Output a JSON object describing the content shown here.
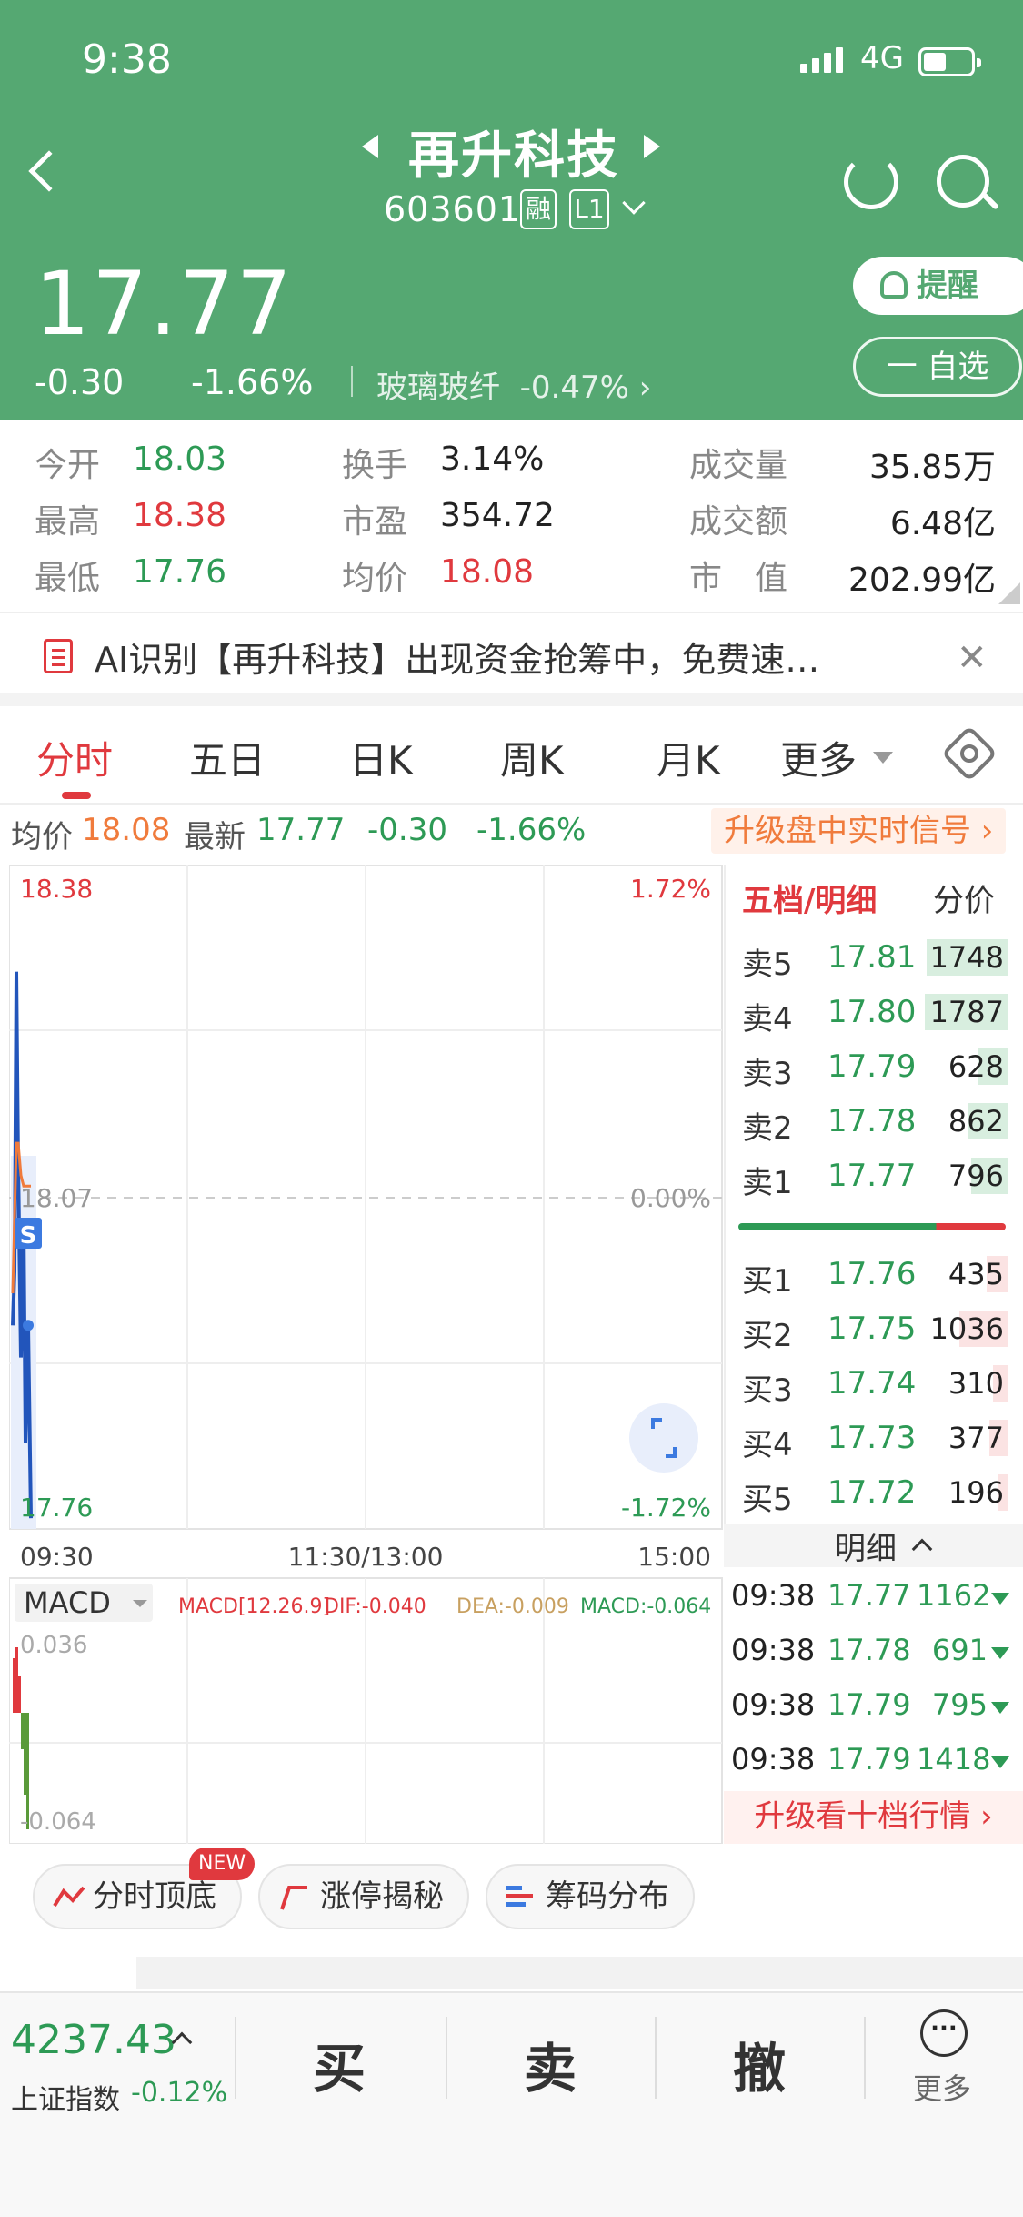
{
  "status_bar": {
    "time": "9:38",
    "network": "4G"
  },
  "header": {
    "stock_name": "再升科技",
    "stock_code": "603601",
    "badge_margin": "融",
    "badge_level": "L1",
    "price": "17.77",
    "change": "-0.30",
    "change_pct": "-1.66%",
    "sector_name": "玻璃玻纤",
    "sector_change": "-0.47%",
    "remind_label": "提醒",
    "watchlist_label": "一 自选"
  },
  "stats": {
    "open_label": "今开",
    "open": "18.03",
    "high_label": "最高",
    "high": "18.38",
    "low_label": "最低",
    "low": "17.76",
    "turnover_label": "换手",
    "turnover": "3.14%",
    "pe_label": "市盈",
    "pe": "354.72",
    "avg_label": "均价",
    "avg": "18.08",
    "volume_label": "成交量",
    "volume": "35.85万",
    "amount_label": "成交额",
    "amount": "6.48亿",
    "mktcap_label": "市　值",
    "mktcap": "202.99亿"
  },
  "ai_banner": {
    "text": "AI识别【再升科技】出现资金抢筹中，免费速…",
    "close": "✕"
  },
  "tabs": [
    "分时",
    "五日",
    "日K",
    "周K",
    "月K",
    "更多"
  ],
  "info_line": {
    "avg_label": "均价",
    "avg": "18.08",
    "latest_label": "最新",
    "latest": "17.77",
    "change": "-0.30",
    "change_pct": "-1.66%",
    "upgrade": "升级盘中实时信号 ›"
  },
  "chart_data": [
    {
      "type": "line",
      "title": "分时",
      "y_labels": {
        "top": "18.38",
        "mid": "18.07",
        "bottom": "17.76"
      },
      "pct_labels": {
        "top": "1.72%",
        "mid": "0.00%",
        "bottom": "-1.72%"
      },
      "ylim": [
        17.76,
        18.38
      ],
      "x_labels": [
        "09:30",
        "11:30/13:00",
        "15:00"
      ],
      "series": [
        {
          "name": "价格",
          "values": [
            17.95,
            18.0,
            18.28,
            18.1,
            17.92,
            18.05,
            17.84,
            17.95,
            17.77
          ]
        },
        {
          "name": "均价",
          "values": [
            17.98,
            18.05,
            18.12,
            18.12,
            18.09,
            18.08,
            18.08,
            18.08,
            18.08
          ]
        }
      ],
      "marker": "S",
      "grid": true
    },
    {
      "type": "bar",
      "title": "MACD",
      "params": "MACD[12.26.9]",
      "dif": "DIF:-0.040",
      "dea": "DEA:-0.009",
      "macd": "MACD:-0.064",
      "y_labels": {
        "top": "0.036",
        "bottom": "-0.064"
      },
      "ylim": [
        -0.064,
        0.036
      ],
      "values": [
        0.03,
        0.036,
        0.02,
        -0.02,
        -0.045,
        -0.064
      ]
    }
  ],
  "orderbook": {
    "title": "五档/明细",
    "price_tab": "分价",
    "asks": [
      {
        "label": "卖5",
        "price": "17.81",
        "vol": "1748",
        "ratio": 0.95
      },
      {
        "label": "卖4",
        "price": "17.80",
        "vol": "1787",
        "ratio": 0.97
      },
      {
        "label": "卖3",
        "price": "17.79",
        "vol": "628",
        "ratio": 0.34
      },
      {
        "label": "卖2",
        "price": "17.78",
        "vol": "862",
        "ratio": 0.47
      },
      {
        "label": "卖1",
        "price": "17.77",
        "vol": "796",
        "ratio": 0.43
      }
    ],
    "bids": [
      {
        "label": "买1",
        "price": "17.76",
        "vol": "435",
        "ratio": 0.24
      },
      {
        "label": "买2",
        "price": "17.75",
        "vol": "1036",
        "ratio": 0.56
      },
      {
        "label": "买3",
        "price": "17.74",
        "vol": "310",
        "ratio": 0.17
      },
      {
        "label": "买4",
        "price": "17.73",
        "vol": "377",
        "ratio": 0.21
      },
      {
        "label": "买5",
        "price": "17.72",
        "vol": "196",
        "ratio": 0.11
      }
    ],
    "buy_sell_ratio": 0.74
  },
  "ticks": {
    "title": "明细",
    "rows": [
      {
        "time": "09:38",
        "price": "17.77",
        "vol": "1162"
      },
      {
        "time": "09:38",
        "price": "17.78",
        "vol": "691"
      },
      {
        "time": "09:38",
        "price": "17.79",
        "vol": "795"
      },
      {
        "time": "09:38",
        "price": "17.79",
        "vol": "1418"
      }
    ],
    "upgrade": "升级看十档行情 ›"
  },
  "tools": {
    "intraday": "分时顶底",
    "new_tag": "NEW",
    "limitup": "涨停揭秘",
    "chips": "筹码分布"
  },
  "bottom": {
    "index_value": "4237.43",
    "index_name": "上证指数",
    "index_change": "-0.12%",
    "buy": "买",
    "sell": "卖",
    "cancel": "撤",
    "more": "更多"
  },
  "colors": {
    "brand_green": "#55a872",
    "up": "#e0393e",
    "down": "#2d9a55",
    "avg_line": "#f07b3c"
  }
}
